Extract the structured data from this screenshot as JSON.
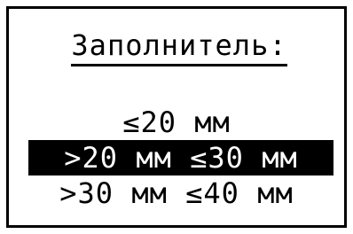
{
  "screen": {
    "title": "Заполнитель:"
  },
  "menu": {
    "items": [
      {
        "label": "≤20 мм",
        "selected": false
      },
      {
        "label": ">20 мм ≤30 мм",
        "selected": true
      },
      {
        "label": ">30 мм ≤40 мм",
        "selected": false
      }
    ]
  },
  "colors": {
    "background": "#ffffff",
    "foreground": "#000000",
    "highlight": "#000000",
    "highlight_text": "#ffffff"
  }
}
